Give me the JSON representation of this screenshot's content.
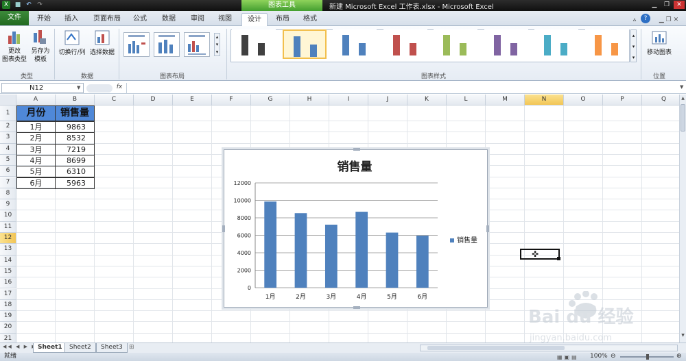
{
  "window": {
    "title": "新建 Microsoft Excel 工作表.xlsx - Microsoft Excel",
    "context_group": "图表工具"
  },
  "tabs": [
    "文件",
    "开始",
    "插入",
    "页面布局",
    "公式",
    "数据",
    "审阅",
    "视图",
    "设计",
    "布局",
    "格式"
  ],
  "ribbon": {
    "type_group": {
      "label": "类型",
      "change_type": "更改\n图表类型",
      "save_template": "另存为\n模板"
    },
    "data_group": {
      "label": "数据",
      "switch": "切换行/列",
      "select": "选择数据"
    },
    "layout_group": {
      "label": "图表布局"
    },
    "styles_group": {
      "label": "图表样式",
      "colors": [
        "#404040",
        "#4f81bd",
        "#4f81bd",
        "#c0504d",
        "#9bbb59",
        "#8064a2",
        "#4bacc6",
        "#f79646"
      ]
    },
    "location_group": {
      "label": "位置",
      "move": "移动图表"
    }
  },
  "formula_bar": {
    "name_box": "N12",
    "fx": "fx",
    "formula": ""
  },
  "columns": [
    "A",
    "B",
    "C",
    "D",
    "E",
    "F",
    "G",
    "H",
    "I",
    "J",
    "K",
    "L",
    "M",
    "N",
    "O",
    "P",
    "Q"
  ],
  "selected_column": "N",
  "rows": [
    "1",
    "2",
    "3",
    "4",
    "5",
    "6",
    "7",
    "8",
    "9",
    "10",
    "11",
    "12",
    "13",
    "14",
    "15",
    "16",
    "17",
    "18",
    "19",
    "20",
    "21"
  ],
  "selected_row": "12",
  "table": {
    "headers": [
      "月份",
      "销售量"
    ],
    "rows": [
      [
        "1月",
        "9863"
      ],
      [
        "2月",
        "8532"
      ],
      [
        "3月",
        "7219"
      ],
      [
        "4月",
        "8699"
      ],
      [
        "5月",
        "6310"
      ],
      [
        "6月",
        "5963"
      ]
    ]
  },
  "chart_data": {
    "type": "bar",
    "title": "销售量",
    "categories": [
      "1月",
      "2月",
      "3月",
      "4月",
      "5月",
      "6月"
    ],
    "series": [
      {
        "name": "销售量",
        "values": [
          9863,
          8532,
          7219,
          8699,
          6310,
          5963
        ],
        "color": "#4f81bd"
      }
    ],
    "ylim": [
      0,
      12000
    ],
    "yticks": [
      "0",
      "2000",
      "4000",
      "6000",
      "8000",
      "10000",
      "12000"
    ],
    "grid": true,
    "legend": "right"
  },
  "sheets": [
    "Sheet1",
    "Sheet2",
    "Sheet3"
  ],
  "active_sheet": "Sheet1",
  "status": {
    "ready": "就绪",
    "zoom": "100%"
  },
  "watermark": {
    "brand": "Bai du 经验",
    "url": "jingyan.baidu.com"
  }
}
